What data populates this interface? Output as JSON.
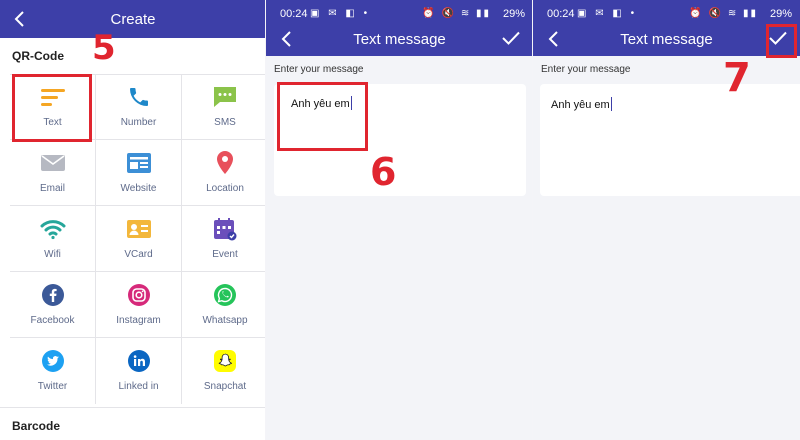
{
  "panel1": {
    "title": "Create",
    "section_qr": "QR-Code",
    "section_barcode": "Barcode",
    "items": [
      {
        "label": "Text",
        "icon": "text-lines-icon"
      },
      {
        "label": "Number",
        "icon": "phone-icon"
      },
      {
        "label": "SMS",
        "icon": "sms-bubble-icon"
      },
      {
        "label": "Email",
        "icon": "envelope-icon"
      },
      {
        "label": "Website",
        "icon": "website-icon"
      },
      {
        "label": "Location",
        "icon": "location-pin-icon"
      },
      {
        "label": "Wifi",
        "icon": "wifi-icon"
      },
      {
        "label": "VCard",
        "icon": "vcard-icon"
      },
      {
        "label": "Event",
        "icon": "calendar-icon"
      },
      {
        "label": "Facebook",
        "icon": "facebook-icon"
      },
      {
        "label": "Instagram",
        "icon": "instagram-icon"
      },
      {
        "label": "Whatsapp",
        "icon": "whatsapp-icon"
      },
      {
        "label": "Twitter",
        "icon": "twitter-icon"
      },
      {
        "label": "Linked in",
        "icon": "linkedin-icon"
      },
      {
        "label": "Snapchat",
        "icon": "snapchat-icon"
      }
    ],
    "step": "5"
  },
  "status": {
    "time": "00:24",
    "battery": "29%"
  },
  "panel2": {
    "title": "Text message",
    "label": "Enter your message",
    "message": "Anh yêu em",
    "step": "6"
  },
  "panel3": {
    "title": "Text message",
    "label": "Enter your message",
    "message": "Anh yêu em",
    "step": "7"
  },
  "colors": {
    "appbar": "#3d3fa8",
    "highlight": "#e0252f",
    "text_icon": "#f5a623",
    "phone_icon": "#1e88c9",
    "sms_icon": "#8bc34a",
    "location_icon": "#e8505b",
    "wifi_icon": "#26a69a",
    "event_icon": "#6b4fbb"
  }
}
